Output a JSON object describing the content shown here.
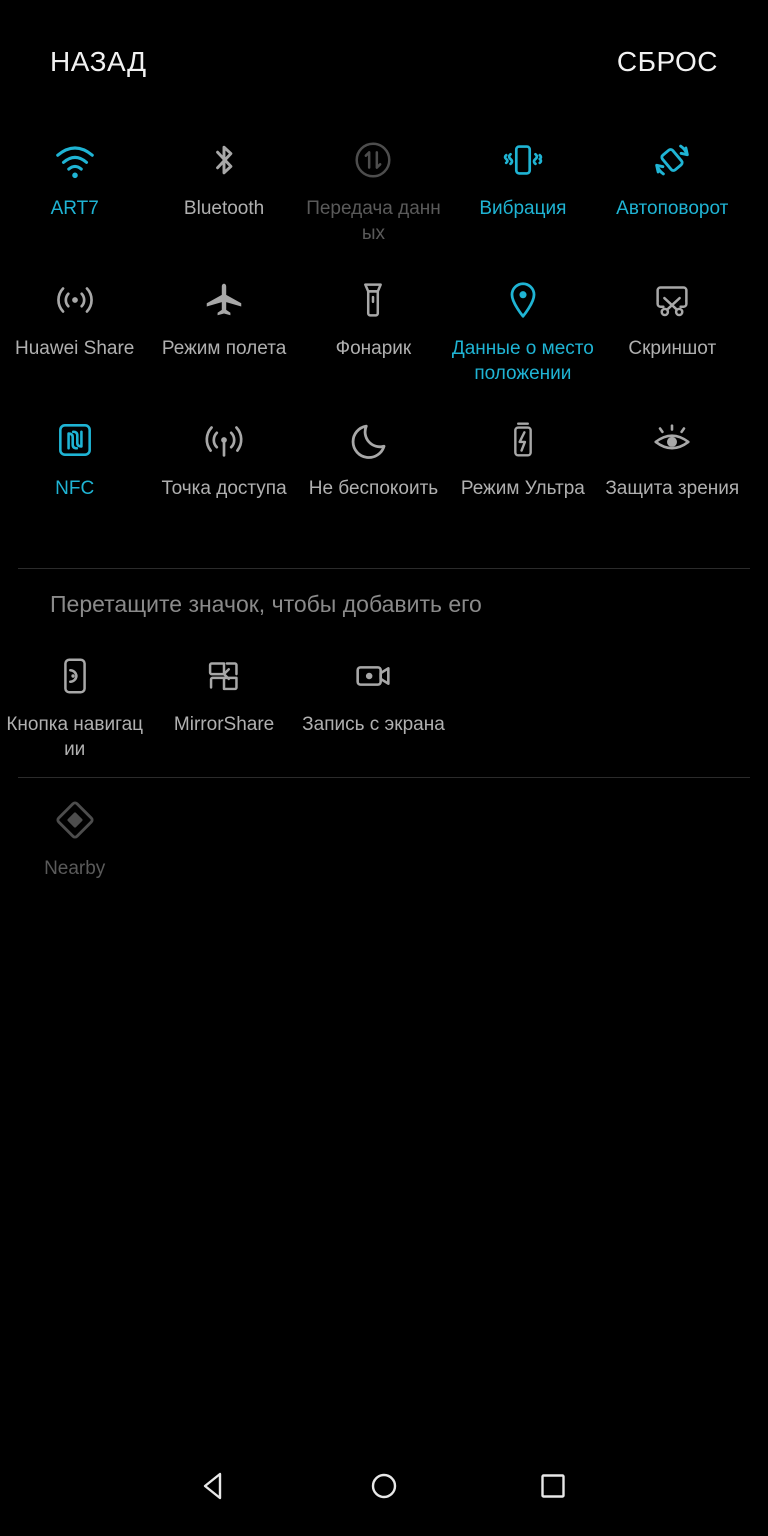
{
  "header": {
    "back_label": "НАЗАД",
    "reset_label": "СБРОС"
  },
  "colors": {
    "background": "#000000",
    "accent_on": "#1fb4d4",
    "label_off": "#b0b0b0",
    "label_disabled": "#5a5a5a",
    "header_text": "#f2f2f2",
    "divider": "#2b2b2b"
  },
  "hint": {
    "text": "Перетащите значок, чтобы добавить его"
  },
  "active_tiles": [
    {
      "label": "ART7",
      "icon": "wifi-icon",
      "state": "on"
    },
    {
      "label": "Bluetooth",
      "icon": "bluetooth-icon",
      "state": "off"
    },
    {
      "label": "Передача данных",
      "icon": "mobile-data-icon",
      "state": "dim"
    },
    {
      "label": "Вибрация",
      "icon": "vibration-icon",
      "state": "on"
    },
    {
      "label": "Автоповорот",
      "icon": "auto-rotate-icon",
      "state": "on"
    },
    {
      "label": "Huawei Share",
      "icon": "huawei-share-icon",
      "state": "off"
    },
    {
      "label": "Режим полета",
      "icon": "airplane-icon",
      "state": "off"
    },
    {
      "label": "Фонарик",
      "icon": "flashlight-icon",
      "state": "off"
    },
    {
      "label": "Данные о местоположении",
      "icon": "location-pin-icon",
      "state": "on"
    },
    {
      "label": "Скриншот",
      "icon": "screenshot-icon",
      "state": "off"
    },
    {
      "label": "NFC",
      "icon": "nfc-icon",
      "state": "on"
    },
    {
      "label": "Точка доступа",
      "icon": "hotspot-icon",
      "state": "off"
    },
    {
      "label": "Не беспокоить",
      "icon": "moon-icon",
      "state": "off"
    },
    {
      "label": "Режим Ультра",
      "icon": "battery-bolt-icon",
      "state": "off"
    },
    {
      "label": "Защита зрения",
      "icon": "eye-comfort-icon",
      "state": "off"
    }
  ],
  "available_tiles": [
    {
      "label": "Кнопка навигации",
      "icon": "nav-button-icon",
      "state": "off"
    },
    {
      "label": "MirrorShare",
      "icon": "mirror-share-icon",
      "state": "off"
    },
    {
      "label": "Запись с экрана",
      "icon": "screen-record-icon",
      "state": "off"
    }
  ],
  "disabled_tiles": [
    {
      "label": "Nearby",
      "icon": "nearby-icon",
      "state": "dim"
    }
  ],
  "navbar": [
    {
      "name": "back-button",
      "icon": "triangle-back-icon"
    },
    {
      "name": "home-button",
      "icon": "circle-home-icon"
    },
    {
      "name": "recents-button",
      "icon": "square-recents-icon"
    }
  ]
}
